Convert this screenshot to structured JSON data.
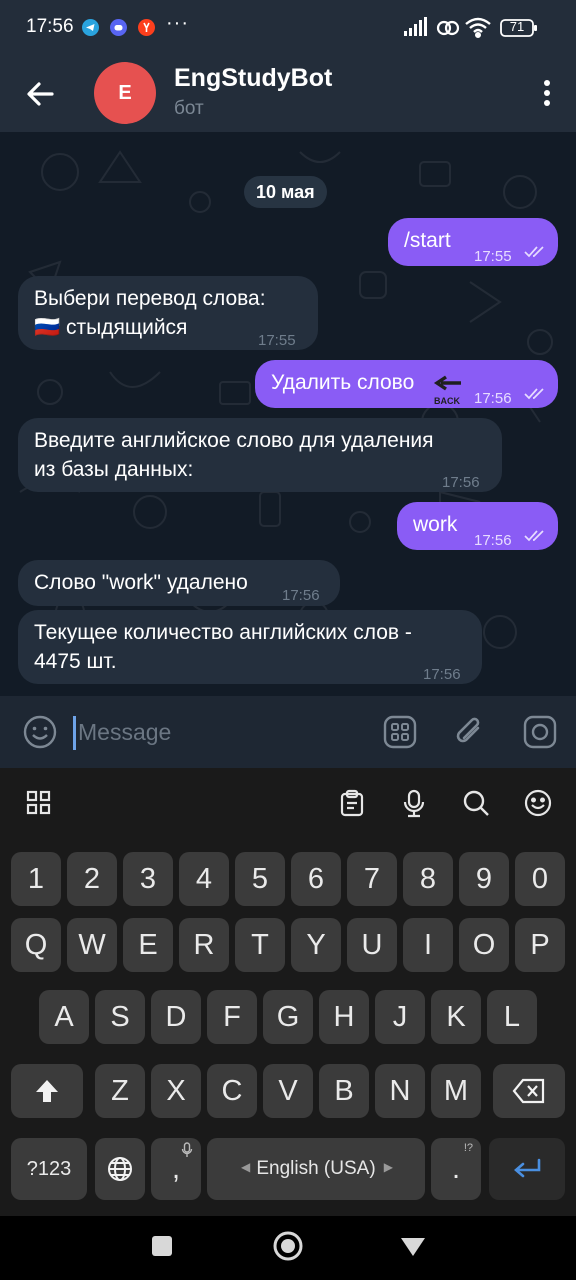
{
  "status_bar": {
    "time": "17:56",
    "more": "···",
    "battery": "71"
  },
  "header": {
    "avatar_letter": "E",
    "title": "EngStudyBot",
    "subtitle": "бот"
  },
  "chat": {
    "date": "10 мая",
    "messages": [
      {
        "dir": "out",
        "text": "/start",
        "time": "17:55"
      },
      {
        "dir": "in",
        "text": "Выбери перевод слова:\n🇷🇺 стыдящийся",
        "time": "17:55"
      },
      {
        "dir": "out",
        "text": "Удалить слово",
        "emoji_label": "BACK",
        "time": "17:56"
      },
      {
        "dir": "in",
        "text": "Введите английское слово для удаления\nиз базы данных:",
        "time": "17:56"
      },
      {
        "dir": "out",
        "text": "work",
        "time": "17:56"
      },
      {
        "dir": "in",
        "text": "Слово \"work\" удалено",
        "time": "17:56"
      },
      {
        "dir": "in",
        "text": "Текущее количество английских слов -\n4475 шт.",
        "time": "17:56"
      }
    ]
  },
  "input": {
    "placeholder": "Message"
  },
  "keyboard": {
    "row_numbers": [
      "1",
      "2",
      "3",
      "4",
      "5",
      "6",
      "7",
      "8",
      "9",
      "0"
    ],
    "row_q": [
      "Q",
      "W",
      "E",
      "R",
      "T",
      "Y",
      "U",
      "I",
      "O",
      "P"
    ],
    "row_a": [
      "A",
      "S",
      "D",
      "F",
      "G",
      "H",
      "J",
      "K",
      "L"
    ],
    "row_z": [
      "Z",
      "X",
      "C",
      "V",
      "B",
      "N",
      "M"
    ],
    "symbols_label": "?123",
    "comma": ",",
    "period": ".",
    "period_hint": "!?",
    "space_label": "English (USA)"
  },
  "colors": {
    "header_bg": "#232d3a",
    "chat_bg": "#121b26",
    "outgoing_bubble": "#8a5cf5",
    "incoming_bubble": "#242f3d",
    "avatar": "#e65150",
    "enter_key_icon": "#4a8fe0"
  }
}
